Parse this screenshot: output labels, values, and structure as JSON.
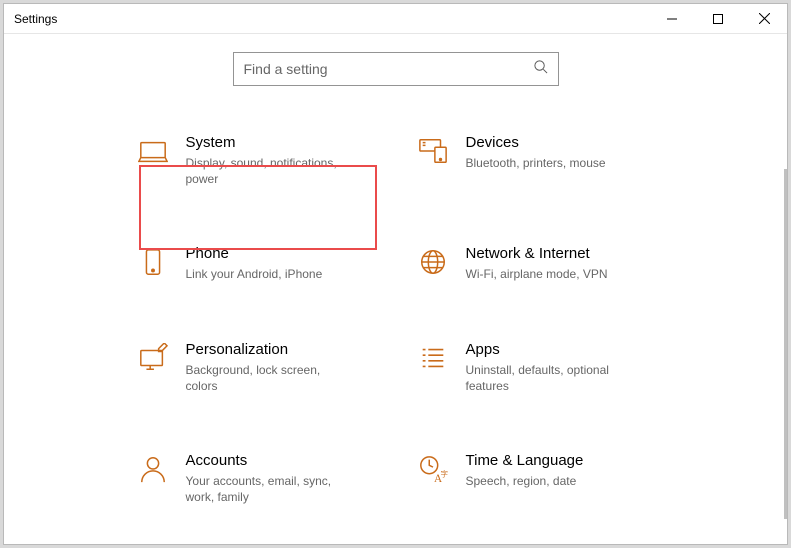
{
  "window": {
    "title": "Settings"
  },
  "search": {
    "placeholder": "Find a setting"
  },
  "tiles": {
    "system": {
      "title": "System",
      "desc": "Display, sound, notifications, power"
    },
    "devices": {
      "title": "Devices",
      "desc": "Bluetooth, printers, mouse"
    },
    "phone": {
      "title": "Phone",
      "desc": "Link your Android, iPhone"
    },
    "network": {
      "title": "Network & Internet",
      "desc": "Wi-Fi, airplane mode, VPN"
    },
    "personalization": {
      "title": "Personalization",
      "desc": "Background, lock screen, colors"
    },
    "apps": {
      "title": "Apps",
      "desc": "Uninstall, defaults, optional features"
    },
    "accounts": {
      "title": "Accounts",
      "desc": "Your accounts, email, sync, work, family"
    },
    "time": {
      "title": "Time & Language",
      "desc": "Speech, region, date"
    }
  }
}
